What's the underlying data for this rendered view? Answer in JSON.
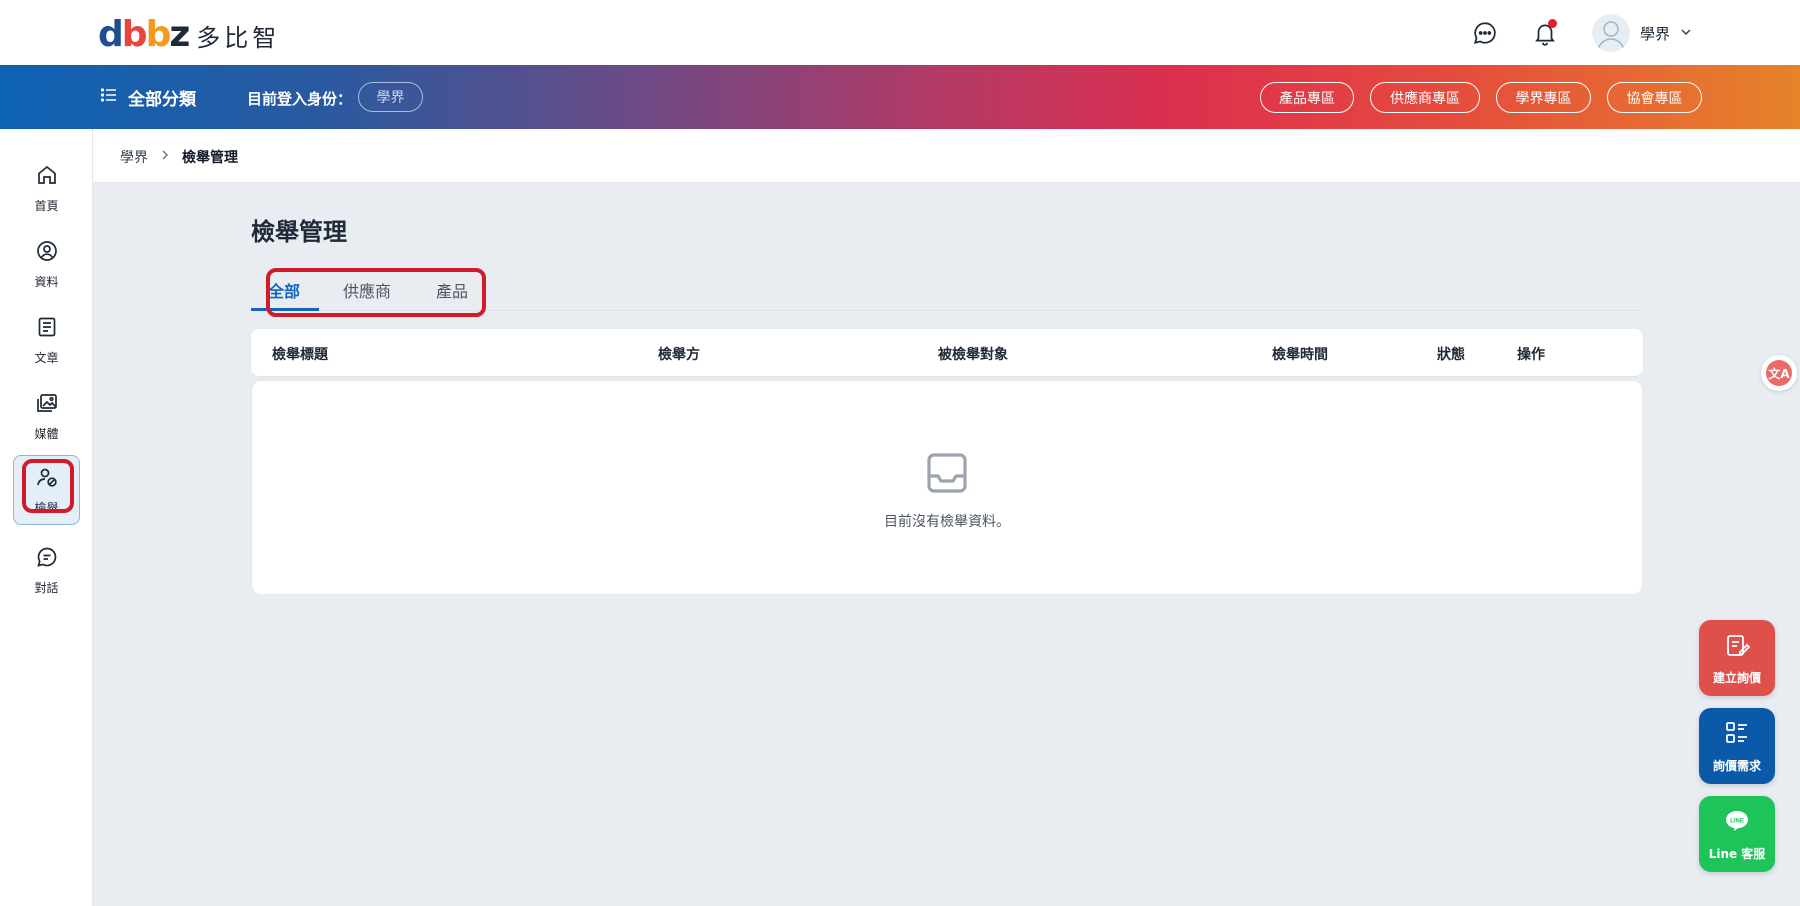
{
  "brand": {
    "logo_text": "dbbz",
    "name_cn": "多比智"
  },
  "header": {
    "user_name": "學界",
    "has_notification": true
  },
  "gradient_bar": {
    "all_categories": "全部分類",
    "login_identity_label": "目前登入身份：",
    "role": "學界",
    "zones": [
      "產品專區",
      "供應商專區",
      "學界專區",
      "協會專區"
    ]
  },
  "sidebar": {
    "items": [
      {
        "label": "首頁",
        "icon": "home-icon"
      },
      {
        "label": "資料",
        "icon": "profile-icon"
      },
      {
        "label": "文章",
        "icon": "article-icon"
      },
      {
        "label": "媒體",
        "icon": "media-icon"
      },
      {
        "label": "檢舉",
        "icon": "report-user-icon",
        "active": true
      },
      {
        "label": "對話",
        "icon": "chat-icon"
      }
    ]
  },
  "breadcrumb": {
    "parent": "學界",
    "current": "檢舉管理"
  },
  "main": {
    "title": "檢舉管理",
    "tabs": [
      "全部",
      "供應商",
      "產品"
    ],
    "active_tab": "全部",
    "table": {
      "columns": [
        "檢舉標題",
        "檢舉方",
        "被檢舉對象",
        "檢舉時間",
        "狀態",
        "操作"
      ],
      "rows": [],
      "empty_text": "目前沒有檢舉資料。"
    }
  },
  "floating": {
    "translate_glyph": "文A",
    "create_inquiry": "建立詢價",
    "inquiry_needs": "詢價需求",
    "line_service": "Line 客服",
    "line_badge": "LINE"
  },
  "colors": {
    "accent_blue": "#1565c0",
    "annotation_red": "#d11a2a",
    "fab_red": "#e0504b",
    "fab_blue": "#0b5aa9",
    "fab_green": "#1ec45a"
  }
}
